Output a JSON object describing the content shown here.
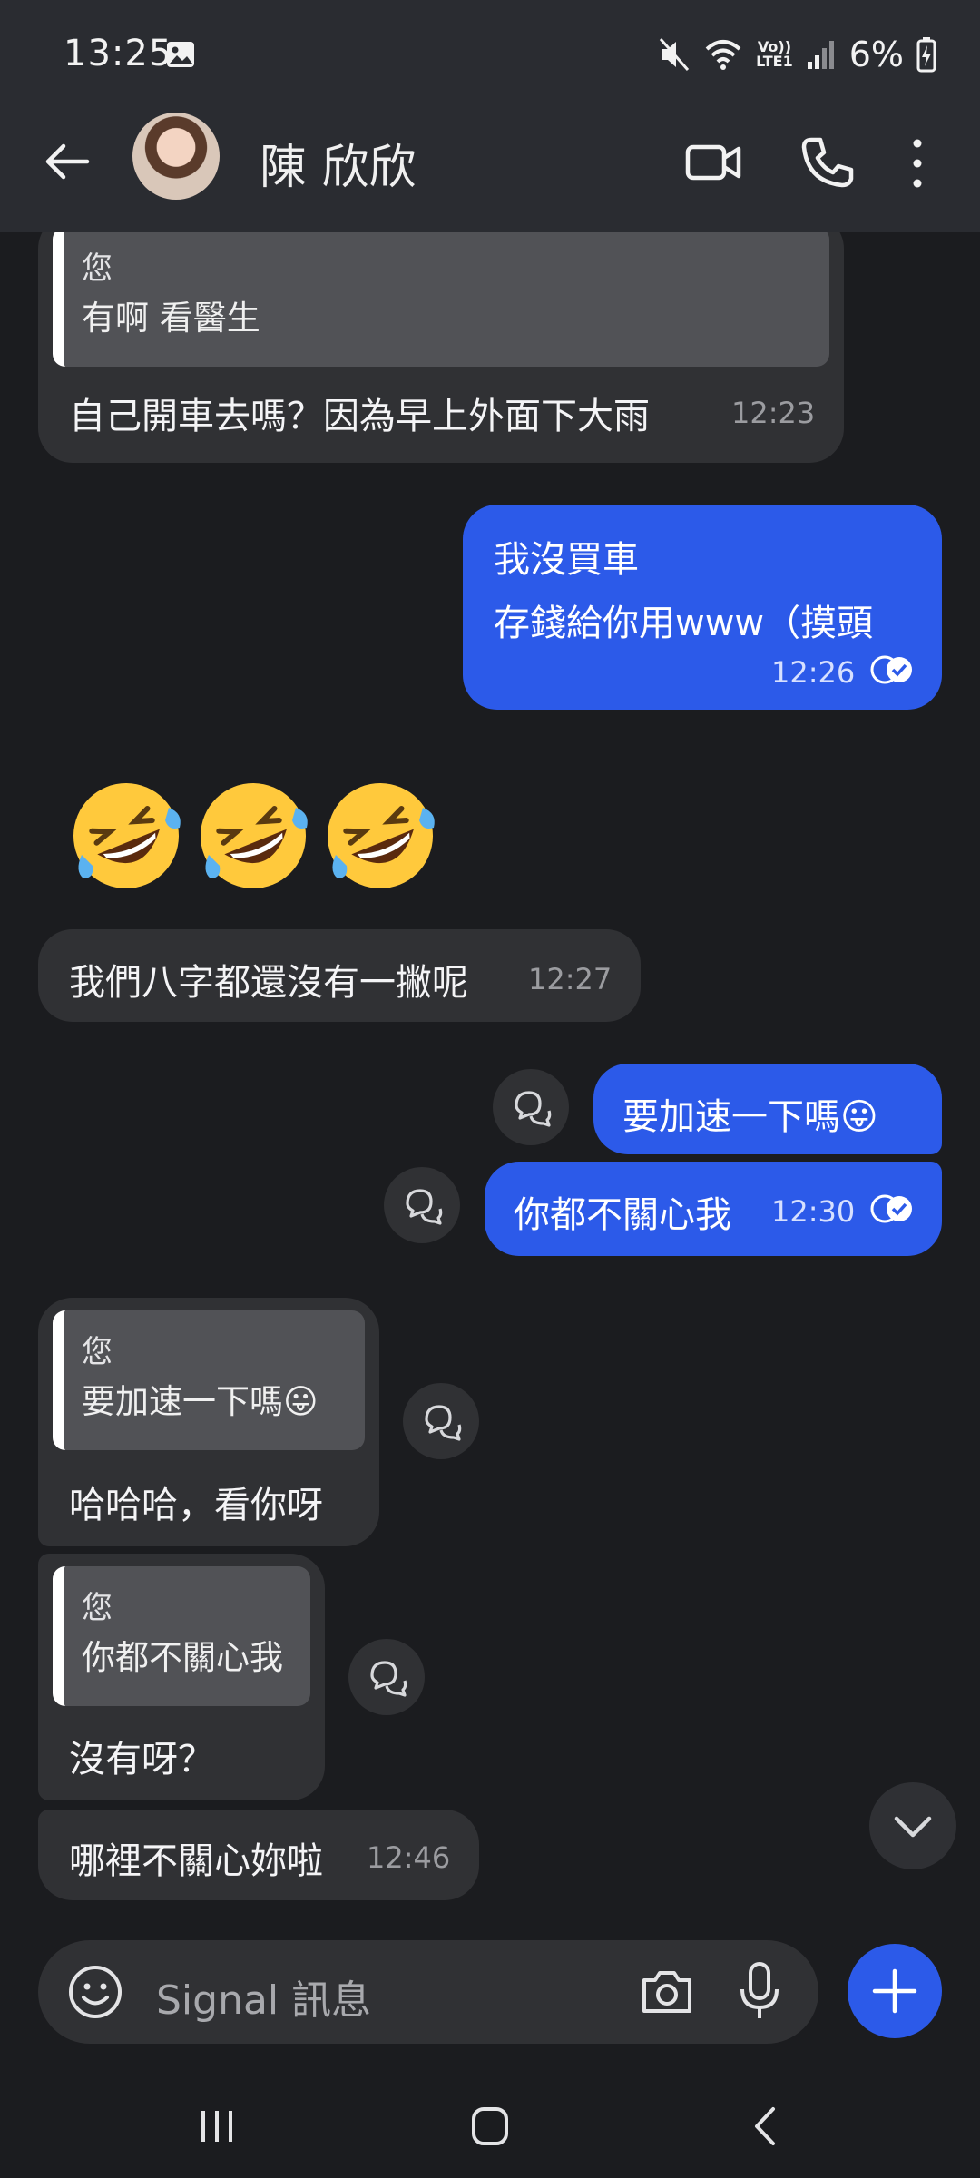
{
  "status_bar": {
    "time": "13:25",
    "battery": "6%",
    "net_label_top": "Vo))",
    "net_label_bottom": "LTE1"
  },
  "header": {
    "contact_name": "陳 欣欣"
  },
  "messages": {
    "m1": {
      "quote_author": "您",
      "quote_text": "有啊 看醫生",
      "text": "自己開車去嗎？因為早上外面下大雨",
      "time": "12:23"
    },
    "m2": {
      "line1": "我沒買車",
      "line2": "存錢給你用www（摸頭",
      "time": "12:26"
    },
    "emojis": [
      "🤣",
      "🤣",
      "🤣"
    ],
    "m3": {
      "text": "我們八字都還沒有一撇呢",
      "time": "12:27"
    },
    "m4": {
      "text": "要加速一下嗎😛"
    },
    "m5": {
      "text": "你都不關心我",
      "time": "12:30"
    },
    "m6": {
      "quote_author": "您",
      "quote_text": "要加速一下嗎😛",
      "text": "哈哈哈，看你呀"
    },
    "m7": {
      "quote_author": "您",
      "quote_text": "你都不關心我",
      "text": "沒有呀？"
    },
    "m8": {
      "text": "哪裡不關心妳啦",
      "time": "12:46"
    }
  },
  "composer": {
    "placeholder": "Signal 訊息"
  },
  "colors": {
    "accent": "#2c5ae9",
    "incoming_bubble": "#303134",
    "background": "#1b1c1f"
  },
  "icons": {
    "back": "arrow-left-icon",
    "video": "video-call-icon",
    "call": "phone-icon",
    "more": "more-vertical-icon",
    "react": "reply-bubble-icon",
    "scroll": "chevron-down-icon",
    "emoji": "smiley-icon",
    "camera": "camera-icon",
    "mic": "microphone-icon",
    "plus": "plus-icon"
  }
}
